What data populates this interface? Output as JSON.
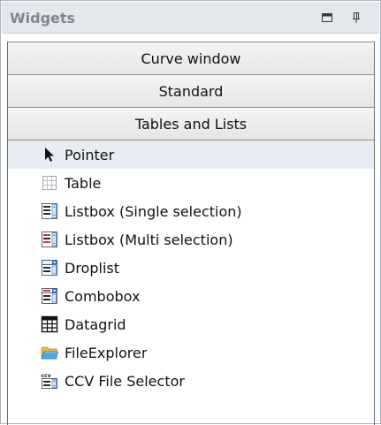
{
  "panel": {
    "title": "Widgets",
    "buttons": [
      {
        "icon": "maximize-icon"
      },
      {
        "icon": "pin-icon"
      }
    ]
  },
  "categories": [
    {
      "label": "Curve window"
    },
    {
      "label": "Standard"
    },
    {
      "label": "Tables and Lists"
    }
  ],
  "items": [
    {
      "label": "Pointer",
      "icon": "pointer-icon",
      "selected": true
    },
    {
      "label": "Table",
      "icon": "table-icon"
    },
    {
      "label": "Listbox (Single selection)",
      "icon": "listbox-single-icon"
    },
    {
      "label": "Listbox (Multi selection)",
      "icon": "listbox-multi-icon"
    },
    {
      "label": "Droplist",
      "icon": "droplist-icon"
    },
    {
      "label": "Combobox",
      "icon": "combobox-icon"
    },
    {
      "label": "Datagrid",
      "icon": "datagrid-icon"
    },
    {
      "label": "FileExplorer",
      "icon": "folder-icon"
    },
    {
      "label": "CCV File Selector",
      "icon": "ccv-file-selector-icon"
    }
  ],
  "colors": {
    "title_text": "#7d8792",
    "titlebar_bg": "#e4e7eb",
    "selected_row": "#e9edf3",
    "multi_accent": "#d23a2a",
    "list_accent": "#2b6cc4"
  }
}
